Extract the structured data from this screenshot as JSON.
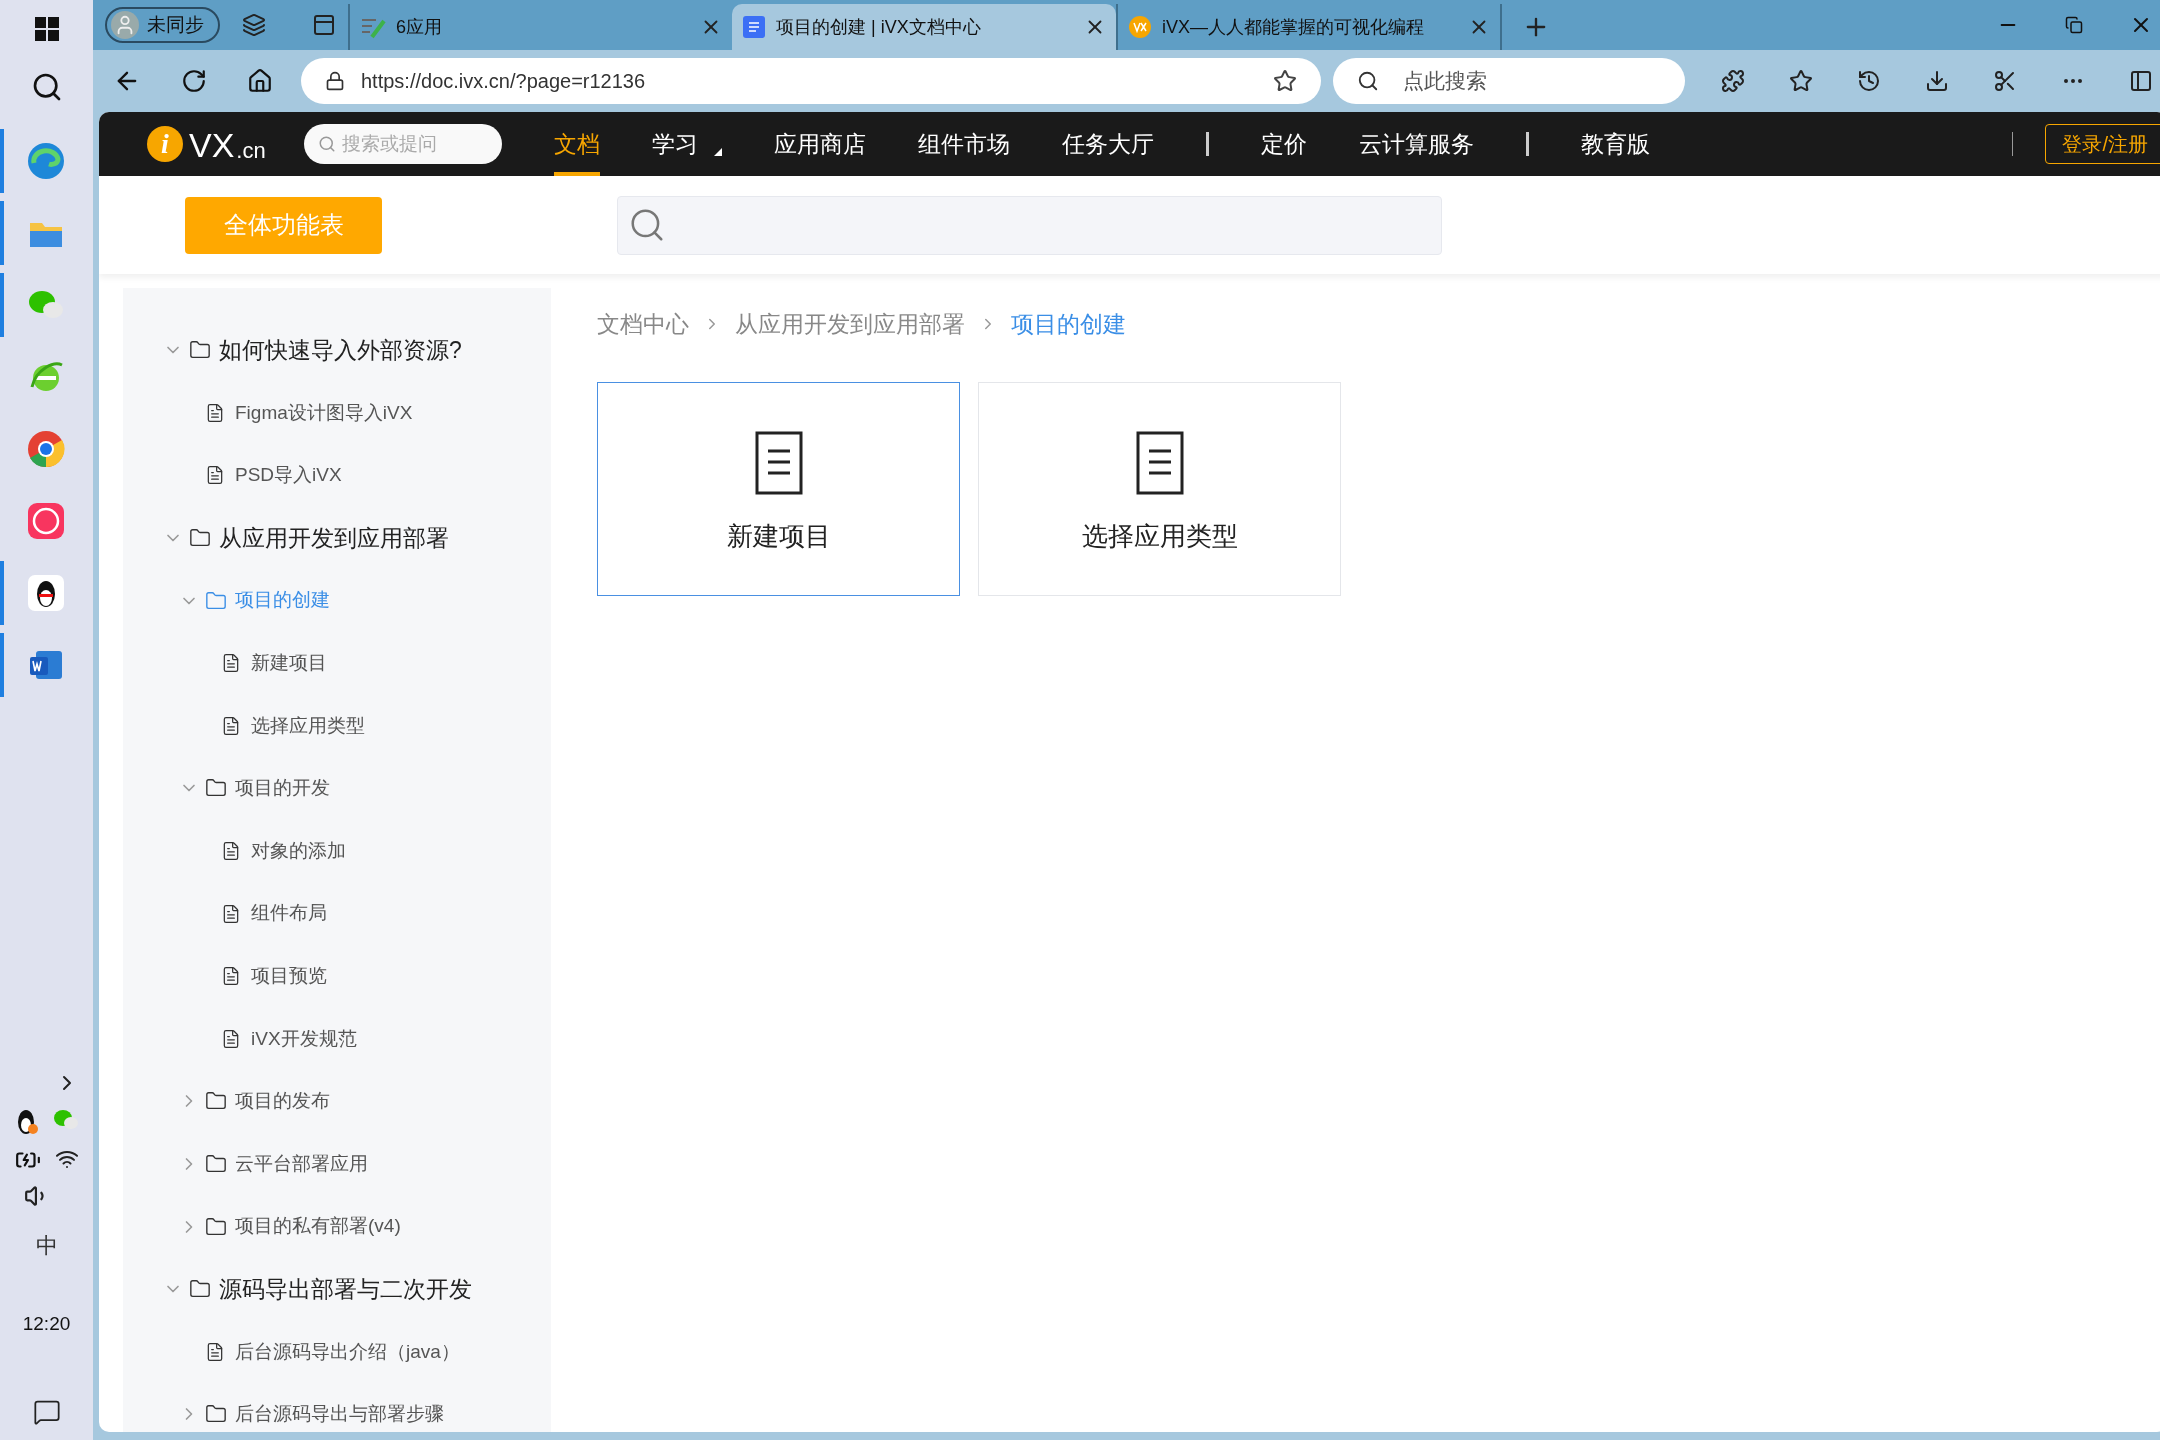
{
  "taskbar": {
    "apps": [
      {
        "kind": "edge",
        "running": true
      },
      {
        "kind": "explorer",
        "running": true
      },
      {
        "kind": "wechat",
        "running": true
      },
      {
        "kind": "ie",
        "running": false
      },
      {
        "kind": "chrome",
        "running": false
      },
      {
        "kind": "meitu",
        "running": false
      },
      {
        "kind": "qq",
        "running": true
      },
      {
        "kind": "word",
        "running": true
      }
    ],
    "ime": "中",
    "clock": "12:20"
  },
  "browser": {
    "profile": "未同步",
    "tabs": [
      {
        "kind": "app",
        "title": "6应用",
        "selected": false
      },
      {
        "kind": "doc",
        "title": "项目的创建 | iVX文档中心",
        "selected": true
      },
      {
        "kind": "logo",
        "title": "iVX—人人都能掌握的可视化编程",
        "selected": false
      }
    ],
    "url": "https://doc.ivx.cn/?page=r12136",
    "search_placeholder": "点此搜索"
  },
  "site_nav": {
    "logo": {
      "mark": "i",
      "text": "VX",
      "suffix": ".cn"
    },
    "search_placeholder": "搜索或提问",
    "items": [
      {
        "kind": "link",
        "label": "文档",
        "selected": true
      },
      {
        "kind": "menu",
        "label": "学习",
        "selected": false
      },
      {
        "kind": "link",
        "label": "应用商店",
        "selected": false
      },
      {
        "kind": "link",
        "label": "组件市场",
        "selected": false
      },
      {
        "kind": "link",
        "label": "任务大厅",
        "selected": false
      },
      {
        "kind": "separator"
      },
      {
        "kind": "link",
        "label": "定价",
        "selected": false
      },
      {
        "kind": "link",
        "label": "云计算服务",
        "selected": false
      },
      {
        "kind": "separator"
      },
      {
        "kind": "link",
        "label": "教育版",
        "selected": false
      }
    ],
    "login": "登录/注册"
  },
  "toolbar": {
    "all_features": "全体功能表"
  },
  "sidebar": {
    "tree": [
      {
        "kind": "folder",
        "label": "如何快速导入外部资源?",
        "expanded": true,
        "selected": false,
        "children": [
          {
            "kind": "doc",
            "label": "Figma设计图导入iVX",
            "selected": false
          },
          {
            "kind": "doc",
            "label": "PSD导入iVX",
            "selected": false
          }
        ]
      },
      {
        "kind": "folder",
        "label": "从应用开发到应用部署",
        "expanded": true,
        "selected": false,
        "children": [
          {
            "kind": "folder",
            "label": "项目的创建",
            "expanded": true,
            "selected": true,
            "children": [
              {
                "kind": "doc",
                "label": "新建项目",
                "selected": false
              },
              {
                "kind": "doc",
                "label": "选择应用类型",
                "selected": false
              }
            ]
          },
          {
            "kind": "folder",
            "label": "项目的开发",
            "expanded": true,
            "selected": false,
            "children": [
              {
                "kind": "doc",
                "label": "对象的添加",
                "selected": false
              },
              {
                "kind": "doc",
                "label": "组件布局",
                "selected": false
              },
              {
                "kind": "doc",
                "label": "项目预览",
                "selected": false
              },
              {
                "kind": "doc",
                "label": "iVX开发规范",
                "selected": false
              }
            ]
          },
          {
            "kind": "folder",
            "label": "项目的发布",
            "expanded": false,
            "selected": false
          },
          {
            "kind": "folder",
            "label": "云平台部署应用",
            "expanded": false,
            "selected": false
          },
          {
            "kind": "folder",
            "label": "项目的私有部署(v4)",
            "expanded": false,
            "selected": false
          }
        ]
      },
      {
        "kind": "folder",
        "label": "源码导出部署与二次开发",
        "expanded": true,
        "selected": false,
        "children": [
          {
            "kind": "doc",
            "label": "后台源码导出介绍（java）",
            "selected": false
          },
          {
            "kind": "folder",
            "label": "后台源码导出与部署步骤",
            "expanded": false,
            "selected": false
          }
        ]
      }
    ]
  },
  "breadcrumb": [
    "文档中心",
    "从应用开发到应用部署",
    "项目的创建"
  ],
  "cards": [
    {
      "label": "新建项目",
      "selected": true
    },
    {
      "label": "选择应用类型",
      "selected": false
    }
  ]
}
